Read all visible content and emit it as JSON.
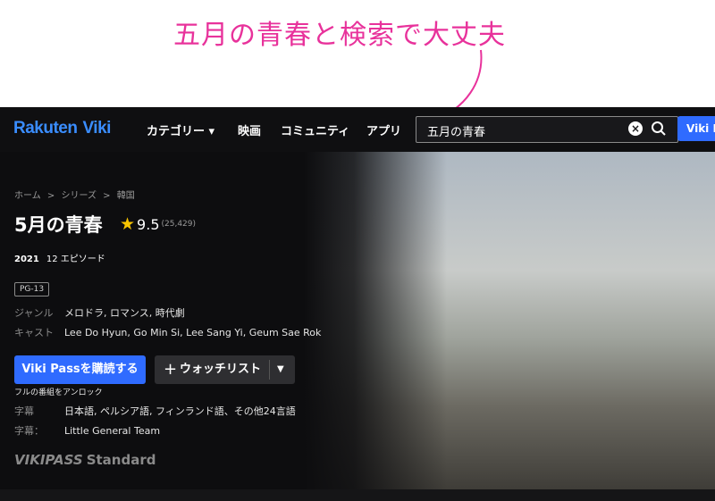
{
  "annotation": {
    "text": "五月の青春と検索で大丈夫",
    "color": "#e8329b"
  },
  "nav": {
    "logo_brand": "Rakuten",
    "logo_viki": "Viki",
    "categories": "カテゴリー ▾",
    "movies": "映画",
    "community": "コミュニティ",
    "apps": "アプリ",
    "search_value": "五月の青春",
    "vikipass_button": "Viki Pass"
  },
  "show": {
    "breadcrumb": [
      "ホーム",
      ">",
      "シリーズ",
      ">",
      "韓国"
    ],
    "title": "5月の青春",
    "rating": "9.5",
    "rating_count": "(25,429)",
    "year": "2021",
    "episodes": "12 エピソード",
    "age_rating": "PG-13",
    "genre_label": "ジャンル",
    "genre_value": "メロドラ, ロマンス, 時代劇",
    "cast_label": "キャスト",
    "cast_value": "Lee Do Hyun, Go Min Si, Lee Sang Yi, Geum Sae Rok",
    "subscribe_button": "Viki Passを購読する",
    "watchlist_button": "ウォッチリスト",
    "unlock_note": "フルの番組をアンロック",
    "subtitles_label": "字幕",
    "subtitles_value": "日本語, ペルシア語, フィンランド語、その他24言語",
    "subtitle_team_label": "字幕：",
    "subtitle_team_value": "Little General Team",
    "plan_vikipass": "VIKIPASS",
    "plan_standard": "Standard"
  },
  "colors": {
    "accent_blue": "#2f6bff",
    "logo_blue": "#3a8dff",
    "star": "#f7c400",
    "background": "#0d0d0f"
  }
}
